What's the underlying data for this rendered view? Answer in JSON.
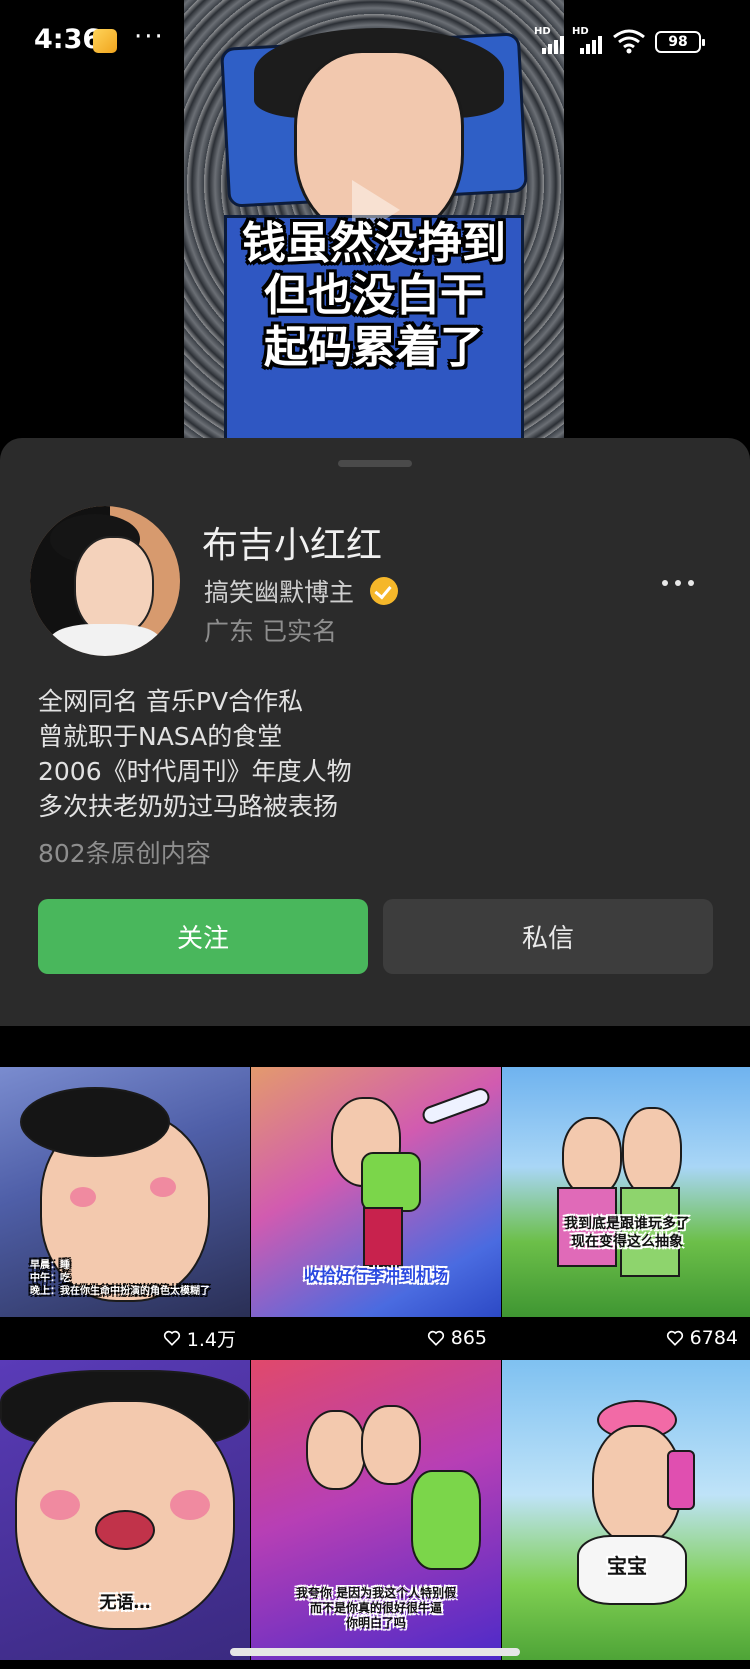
{
  "status_bar": {
    "time": "4:36",
    "more": "···",
    "sim1_label": "HD",
    "sim2_label": "HD",
    "battery": "98"
  },
  "hero": {
    "caption_lines": [
      "钱虽然没挣到",
      "但也没白干",
      "起码累着了"
    ]
  },
  "profile": {
    "name": "布吉小红红",
    "category": "搞笑幽默博主",
    "location": "广东  已实名",
    "bio_lines": [
      "全网同名 音乐PV合作私",
      "曾就职于NASA的食堂",
      "2006《时代周刊》年度人物",
      "多次扶老奶奶过马路被表扬"
    ],
    "original_count": "802条原创内容"
  },
  "actions": {
    "follow_label": "关注",
    "message_label": "私信"
  },
  "videos": [
    {
      "likes": "1.4万",
      "caption": "早晨：睡\n中午：吃\n晚上：我在你生命中扮演的角色太模糊了"
    },
    {
      "likes": "865",
      "caption": "收拾好行李冲到机场"
    },
    {
      "likes": "6784",
      "caption": "我到底是跟谁玩多了\n现在变得这么抽象"
    },
    {
      "likes": "",
      "caption": "无语…"
    },
    {
      "likes": "",
      "caption": "我夸你 是因为我这个人特别假\n而不是你真的很好很牛逼\n你明白了吗"
    },
    {
      "likes": "",
      "caption": "宝宝"
    }
  ],
  "colors": {
    "accent_follow": "#49b75c",
    "sheet_bg": "#2b2b2b",
    "verified": "#f5b72a"
  }
}
